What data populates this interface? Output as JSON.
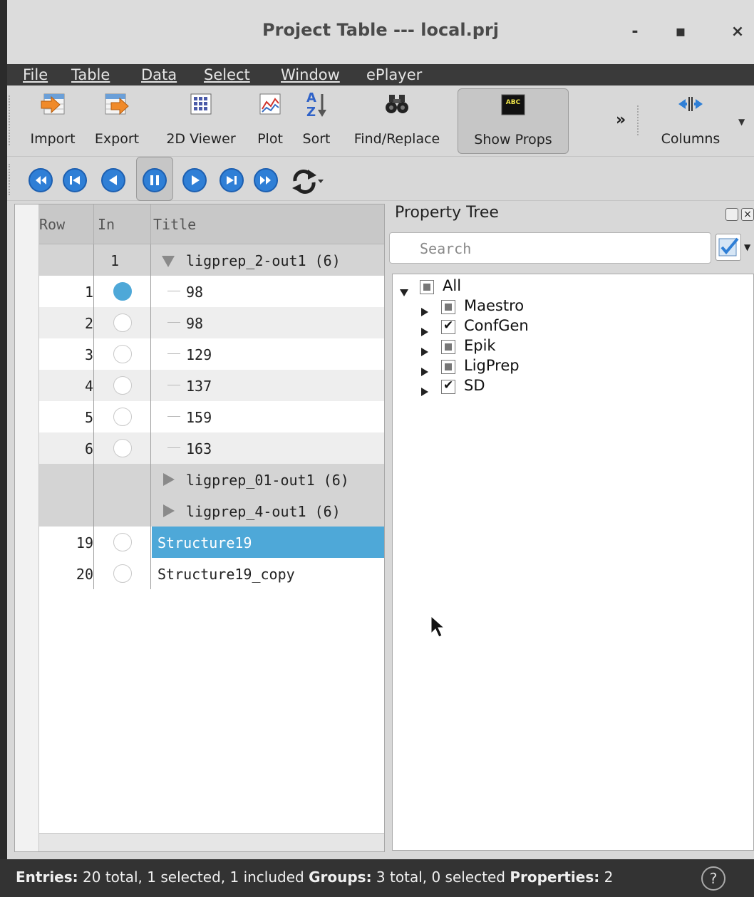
{
  "window": {
    "title": "Project Table --- local.prj",
    "controls": [
      "-",
      "▪",
      "×"
    ]
  },
  "menu": [
    "File",
    "Table",
    "Data",
    "Select",
    "Window",
    "ePlayer"
  ],
  "toolbar": {
    "buttons": [
      {
        "label": "Import",
        "icon": "import-icon"
      },
      {
        "label": "Export",
        "icon": "export-icon"
      },
      {
        "label": "2D Viewer",
        "icon": "grid-icon"
      },
      {
        "label": "Plot",
        "icon": "plot-icon"
      },
      {
        "label": "Sort",
        "icon": "sort-az-icon"
      },
      {
        "label": "Find/Replace",
        "icon": "binoculars-icon"
      },
      {
        "label": "Show Props",
        "icon": "abc-icon"
      },
      {
        "label": "Columns",
        "icon": "columns-icon"
      }
    ],
    "overflow": "»",
    "abc_text": "ABC"
  },
  "player": {
    "buttons": [
      "first-icon",
      "prev-entry-icon",
      "play-back-icon",
      "pause-icon",
      "play-icon",
      "next-entry-icon",
      "last-icon",
      "loop-icon"
    ]
  },
  "table": {
    "headers": {
      "row": "Row",
      "in": "In",
      "title": "Title"
    },
    "rows": [
      {
        "type": "group",
        "in": "1",
        "title": "ligprep_2-out1 (6)",
        "expanded": true
      },
      {
        "type": "entry",
        "row": "1",
        "included": true,
        "title": "98"
      },
      {
        "type": "entry",
        "row": "2",
        "included": false,
        "title": "98"
      },
      {
        "type": "entry",
        "row": "3",
        "included": false,
        "title": "129"
      },
      {
        "type": "entry",
        "row": "4",
        "included": false,
        "title": "137"
      },
      {
        "type": "entry",
        "row": "5",
        "included": false,
        "title": "159"
      },
      {
        "type": "entry",
        "row": "6",
        "included": false,
        "title": "163"
      },
      {
        "type": "group",
        "in": "",
        "title": "ligprep_01-out1 (6)",
        "expanded": false
      },
      {
        "type": "group",
        "in": "",
        "title": "ligprep_4-out1 (6)",
        "expanded": false
      },
      {
        "type": "entry",
        "row": "19",
        "included": false,
        "title": "Structure19",
        "selected": true
      },
      {
        "type": "entry",
        "row": "20",
        "included": false,
        "title": "Structure19_copy"
      }
    ]
  },
  "property_tree": {
    "title": "Property Tree",
    "search_placeholder": "Search",
    "nodes": [
      {
        "label": "All",
        "state": "partial",
        "expanded": true
      },
      {
        "label": "Maestro",
        "state": "partial"
      },
      {
        "label": "ConfGen",
        "state": "checked"
      },
      {
        "label": "Epik",
        "state": "partial"
      },
      {
        "label": "LigPrep",
        "state": "partial"
      },
      {
        "label": "SD",
        "state": "checked"
      }
    ]
  },
  "status": {
    "entries_label": "Entries:",
    "entries_text": " 20 total, 1 selected, 1 included ",
    "groups_label": "Groups:",
    "groups_text": " 3 total, 0 selected ",
    "properties_label": "Properties:",
    "properties_text": " 2",
    "help": "?"
  }
}
